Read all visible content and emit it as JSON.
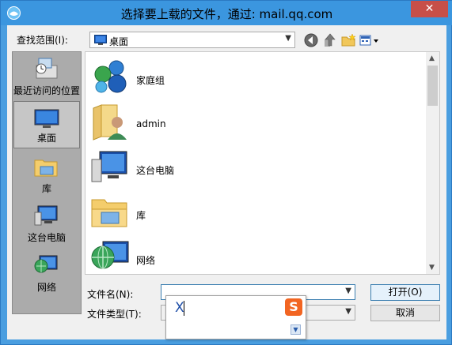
{
  "window": {
    "title": "选择要上载的文件，通过: mail.qq.com",
    "close_glyph": "✕"
  },
  "lookin": {
    "label": "查找范围(I):",
    "value": "桌面",
    "icon": "desktop-icon"
  },
  "toolbar": {
    "buttons": [
      {
        "name": "back-icon"
      },
      {
        "name": "up-folder-icon"
      },
      {
        "name": "new-folder-icon"
      },
      {
        "name": "view-menu-icon"
      }
    ]
  },
  "places": [
    {
      "label": "最近访问的位置",
      "icon": "recent-places-icon",
      "selected": false
    },
    {
      "label": "桌面",
      "icon": "desktop-icon",
      "selected": true
    },
    {
      "label": "库",
      "icon": "library-icon",
      "selected": false
    },
    {
      "label": "这台电脑",
      "icon": "computer-icon",
      "selected": false
    },
    {
      "label": "网络",
      "icon": "network-icon",
      "selected": false
    }
  ],
  "files": [
    {
      "label": "家庭组",
      "icon": "homegroup-icon"
    },
    {
      "label": "admin",
      "icon": "user-folder-icon"
    },
    {
      "label": "这台电脑",
      "icon": "computer-icon"
    },
    {
      "label": "库",
      "icon": "library-icon"
    },
    {
      "label": "网络",
      "icon": "network-icon"
    }
  ],
  "form": {
    "filename_label": "文件名(N):",
    "filename_value": "",
    "filetype_label": "文件类型(T):",
    "filetype_value": ""
  },
  "buttons": {
    "open": "打开(O)",
    "cancel": "取消"
  },
  "ime": {
    "composition": "X",
    "logo_glyph": "S",
    "more_glyph": "▼"
  },
  "colors": {
    "titlebar": "#3b96df",
    "close": "#c74f48",
    "ime_logo": "#f26522"
  }
}
